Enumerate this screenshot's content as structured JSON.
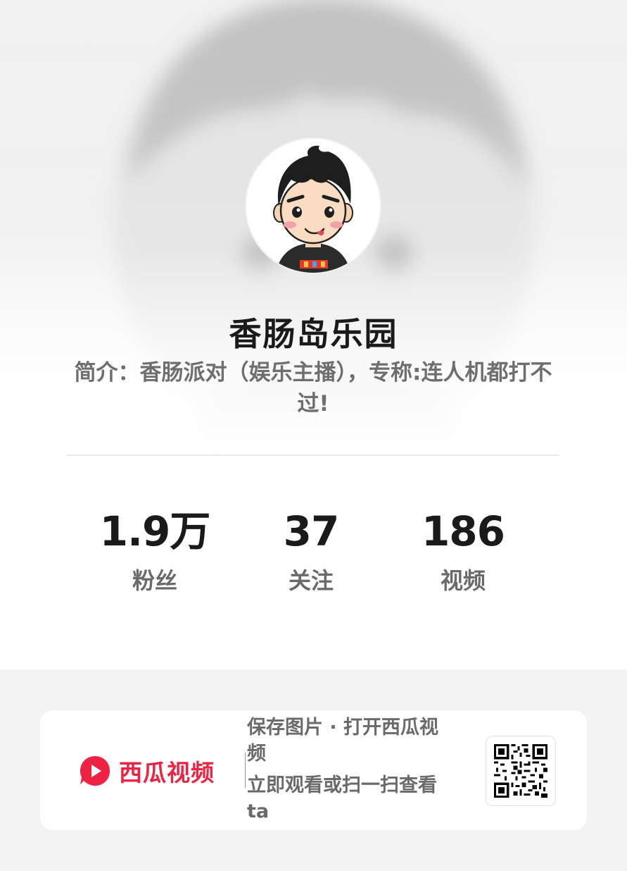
{
  "profile": {
    "name": "香肠岛乐园",
    "bio": "简介：香肠派对（娱乐主播），专称:连人机都打不过!"
  },
  "stats": [
    {
      "value": "1.9万",
      "label": "粉丝"
    },
    {
      "value": "37",
      "label": "关注"
    },
    {
      "value": "186",
      "label": "视频"
    }
  ],
  "share": {
    "brand_name": "西瓜视频",
    "line1": "保存图片 · 打开西瓜视频",
    "line2": "立即观看或扫一扫查看ta"
  },
  "colors": {
    "brand": "#ee2343",
    "text_primary": "#1a1a1a",
    "text_secondary": "#6a6a6a"
  },
  "icons": {
    "brand_logo": "xigua-video-logo-icon",
    "qr": "qr-code-icon"
  }
}
